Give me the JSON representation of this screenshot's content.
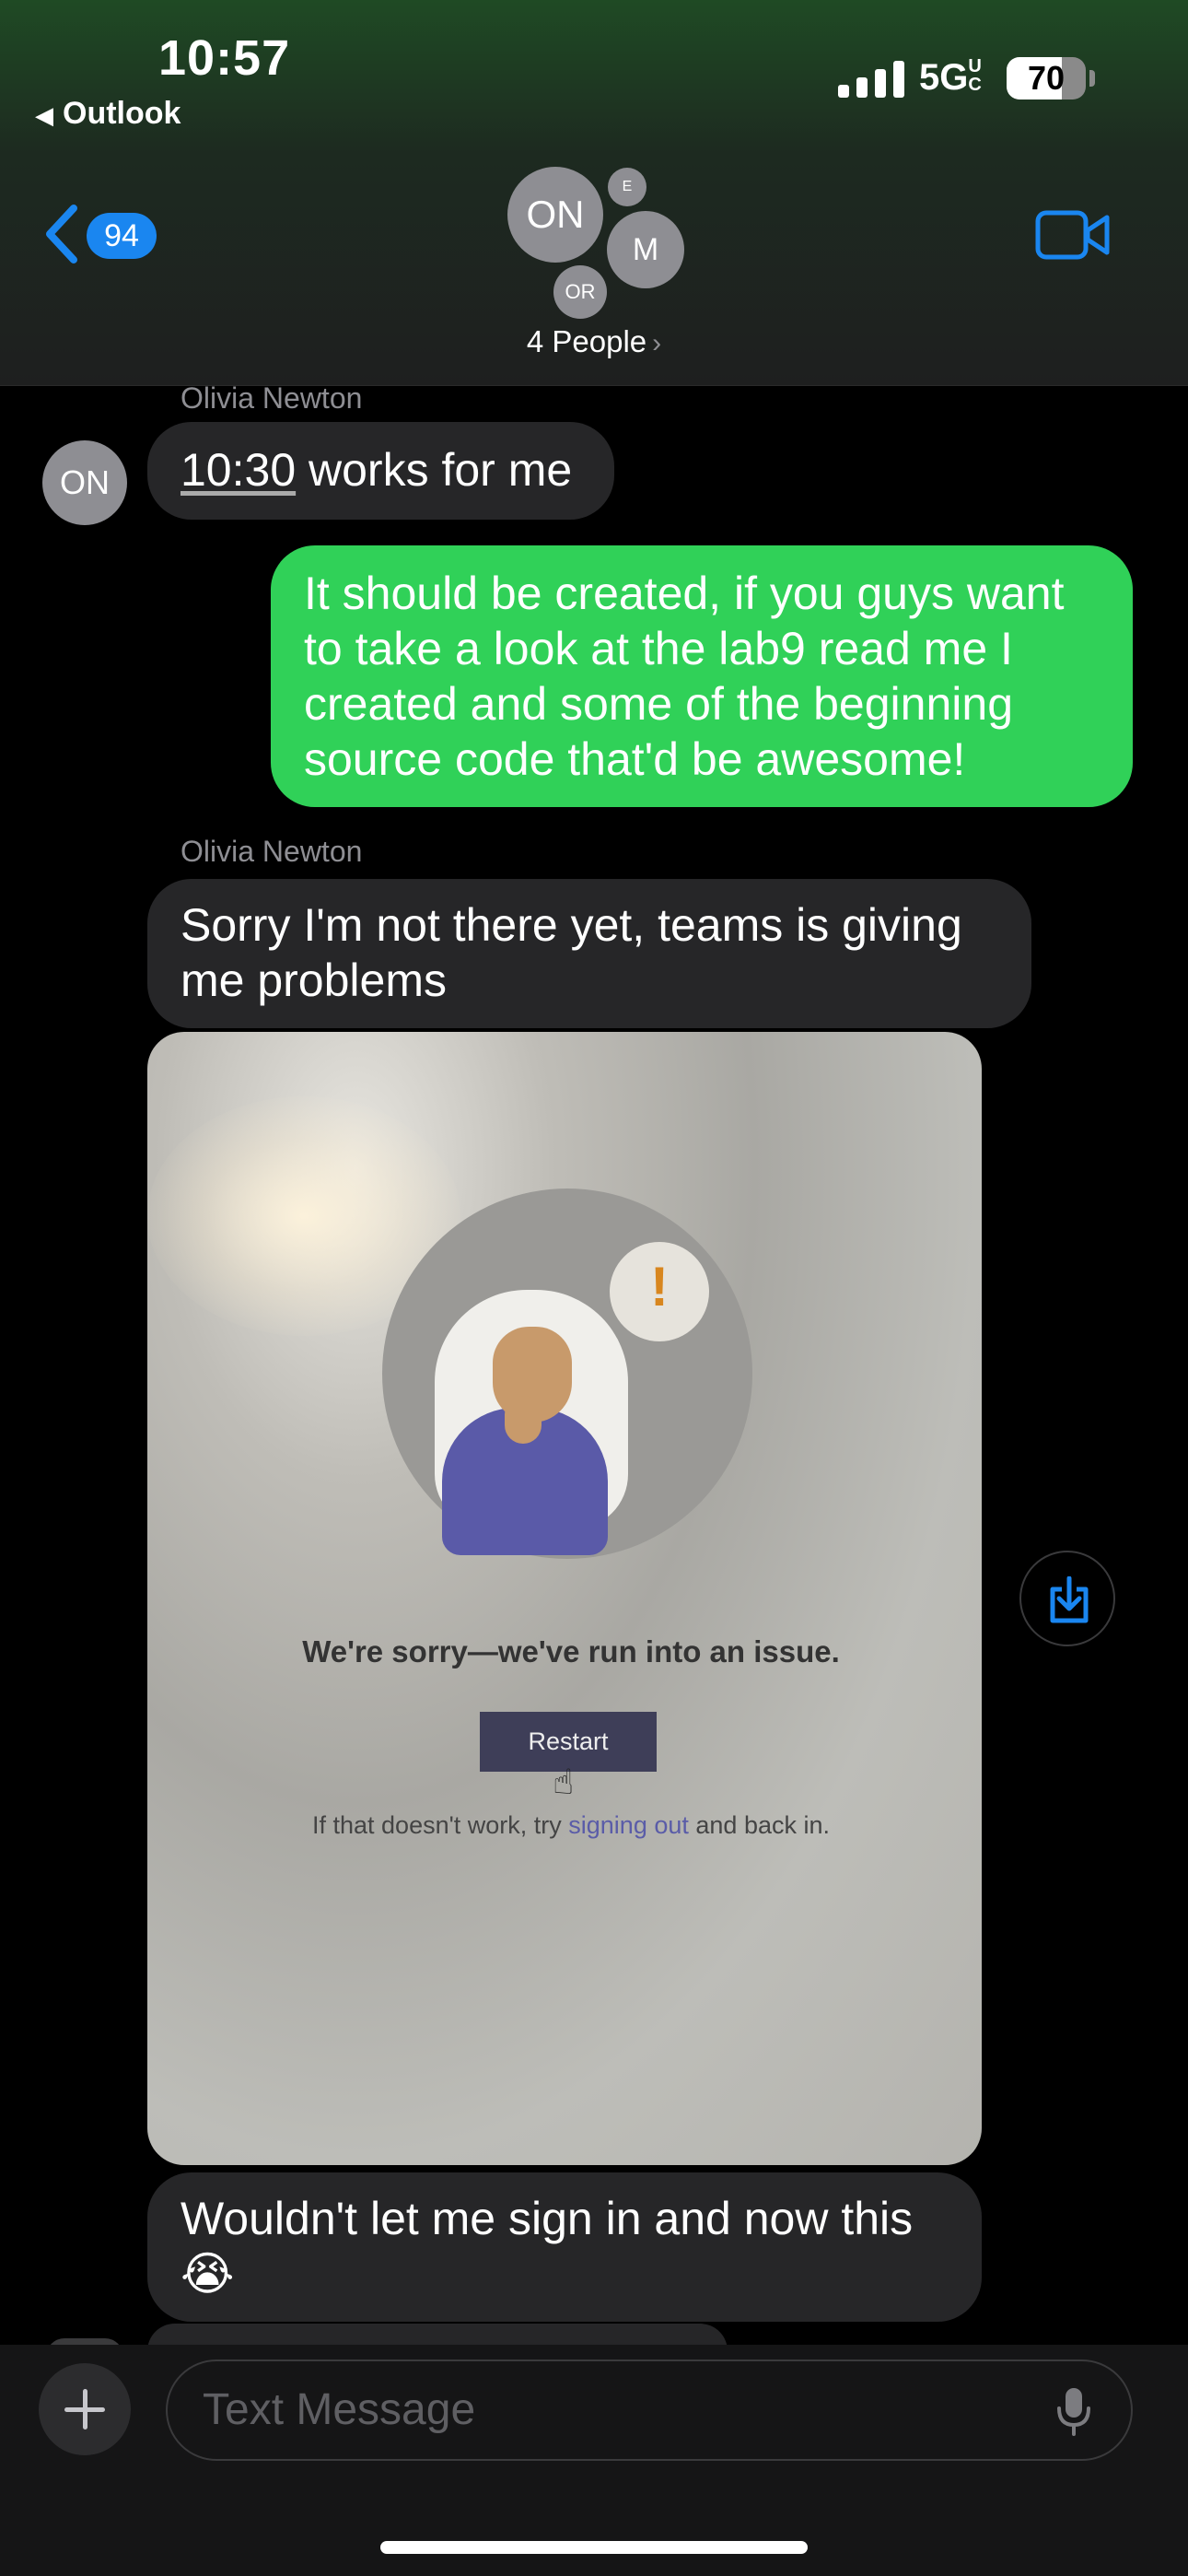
{
  "status_bar": {
    "time": "10:57",
    "back_app": "Outlook",
    "network": "5G",
    "network_sup": "UC",
    "battery": "70",
    "battery_level": 0.7
  },
  "header": {
    "unread_count": "94",
    "avatars": [
      "ON",
      "E",
      "M",
      "OR"
    ],
    "people_label": "4 People",
    "icons": [
      "back-chevron-icon",
      "video-camera-icon",
      "chevron-right-icon"
    ]
  },
  "messages": [
    {
      "sender": "Olivia Newton",
      "avatar": "ON",
      "time_link": "10:30",
      "text": " works for me"
    },
    {
      "text": "It should be created, if you guys want to take a look at the lab9 read me I created and some of the beginning source code that'd be awesome!"
    },
    {
      "sender": "Olivia Newton",
      "text": "Sorry I'm not there yet, teams is giving me problems"
    },
    {
      "photo": {
        "heading": "We're sorry—we've run into an issue.",
        "button": "Restart",
        "sub_before": "If that doesn't work, try ",
        "sub_link": "signing out",
        "sub_after": " and back in."
      }
    },
    {
      "text": "Wouldn't let me sign in and now this 😭"
    }
  ],
  "composer": {
    "placeholder": "Text Message",
    "icons": [
      "plus-icon",
      "microphone-icon",
      "save-download-icon"
    ]
  },
  "colors": {
    "outgoing": "#30d158",
    "incoming": "#262628",
    "accent": "#1a86f0"
  }
}
